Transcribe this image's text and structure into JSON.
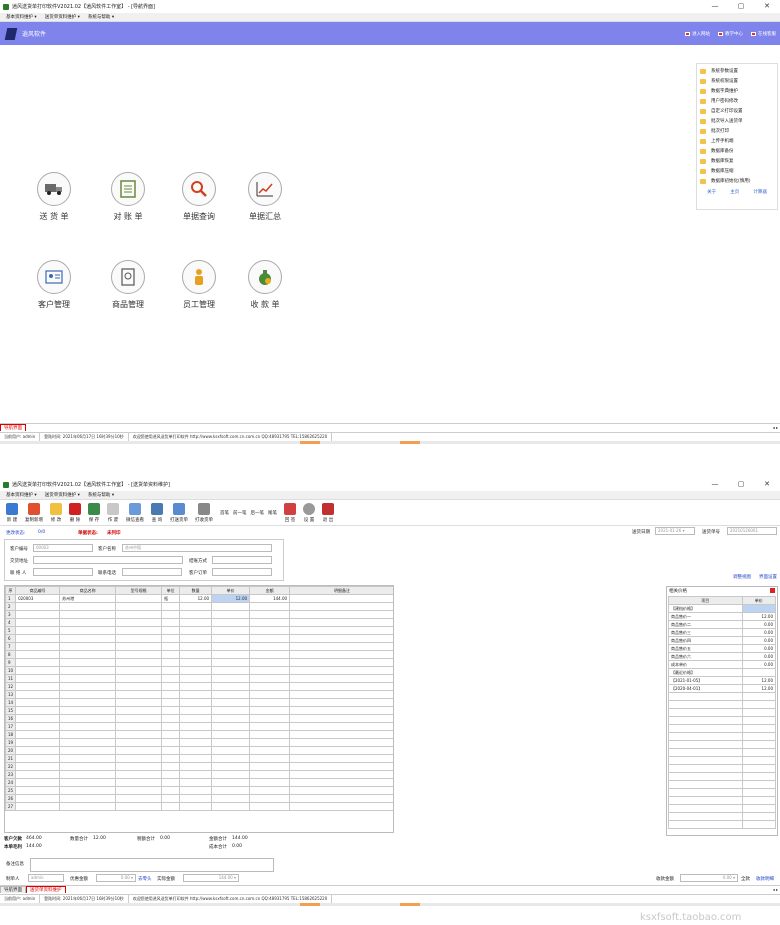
{
  "win1": {
    "title": "逍风送货单打印软件V2021.02【逍风软件工作室】 - [导航界面]",
    "controls": [
      "—",
      "▢",
      "✕"
    ],
    "menu": [
      "基本资料维护 ▾",
      "送货单资料维护 ▾",
      "系统与帮助 ▾"
    ],
    "banner": {
      "name": "逍风软件",
      "links": [
        "进入网站",
        "教学中心",
        "在线客服"
      ]
    },
    "tiles": [
      {
        "label": "送 货 单"
      },
      {
        "label": "对 账 单"
      },
      {
        "label": "单据查询"
      },
      {
        "label": "单据汇总"
      },
      {
        "label": "客户管理"
      },
      {
        "label": "商品管理"
      },
      {
        "label": "员工管理"
      },
      {
        "label": "收 款 单"
      }
    ],
    "sidemenu": [
      "系统参数设置",
      "系统权限设置",
      "数据字典维护",
      "用户密码修改",
      "自定义打印设置",
      "批次导入送货单",
      "批次打印",
      "上传手机端",
      "数据库备份",
      "数据库恢复",
      "数据库压缩",
      "数据库初始化(慎用)"
    ],
    "sidemenu_links": [
      "关于",
      "主页",
      "计算器"
    ],
    "tab": "导航界面",
    "scroll": "◂ ▸",
    "status": [
      "当前用户: admin",
      "登陆时间: 2021年06月17日 16时39分10秒",
      "欢迎您使用逍风送货单打印软件 http://www.ksxfsoft.com.cn.com.cn QQ:48931795 TEL:15862625220"
    ]
  },
  "win2": {
    "title": "逍风送货单打印软件V2021.02【逍风软件工作室】 - [送货单资料维护]",
    "controls": [
      "—",
      "▢",
      "✕"
    ],
    "menu": [
      "基本资料维护 ▾",
      "送货单资料维护 ▾",
      "系统与帮助 ▾"
    ],
    "toolbar": [
      "新 建",
      "复制新增",
      "修 改",
      "删 除",
      "保 存",
      "作 废",
      "微信查看",
      "查 询",
      "打送货单",
      "打收货单",
      "首笔",
      "前一笔",
      "后一笔",
      "尾笔",
      "回 签",
      "设 置",
      "退 出"
    ],
    "status_label": "更改状态: ",
    "status_value": "0/0",
    "doc_label": "单据状态:",
    "doc_value": "未列印",
    "date_label": "送货日期",
    "date_value": "2021-01-26 ▾",
    "no_label": "送货单号",
    "no_value": "20210126001",
    "form": {
      "customer_code_label": "客户编号",
      "customer_code": "00003",
      "customer_name_label": "客户名称",
      "customer_name": "苏州中国",
      "address_label": "交货地址",
      "settle_label": "结账方式",
      "contact_label": "联 络 人",
      "phone_label": "联系电话",
      "order_label": "客户订单"
    },
    "links": [
      "调整视图",
      "界面设置"
    ],
    "grid": {
      "headers": [
        "序",
        "商品编号",
        "商品名称",
        "型号规格",
        "单位",
        "数量",
        "单价",
        "金额",
        "明细备注"
      ],
      "rows": [
        [
          "1",
          "020003",
          "苏州港",
          "",
          "瓶",
          "12.00",
          "12.00",
          "144.00",
          ""
        ]
      ]
    },
    "side_title": "相关价格",
    "side_headers": [
      "项目",
      "单价"
    ],
    "side_rows": [
      [
        "【建档价格】",
        ""
      ],
      [
        "商品售价一",
        "12.00"
      ],
      [
        "商品售价二",
        "0.00"
      ],
      [
        "商品售价三",
        "0.00"
      ],
      [
        "商品售价四",
        "0.00"
      ],
      [
        "商品售价五",
        "0.00"
      ],
      [
        "商品售价六",
        "0.00"
      ],
      [
        "成本单价",
        "0.00"
      ],
      [
        "【最近价格】",
        ""
      ],
      [
        "【2021-01-05】",
        "12.00"
      ],
      [
        "【2020-04-01】",
        "12.00"
      ]
    ],
    "totals": {
      "receivable_label": "客户欠款",
      "receivable": "464.00",
      "qty_label": "数量合计",
      "qty": "12.00",
      "tax_label": "税额合计",
      "tax": "0.00",
      "amount_label": "金额合计",
      "amount": "144.00",
      "profit_label": "本单毛利",
      "profit": "144.00",
      "cost_label": "成本合计",
      "cost": "0.00"
    },
    "remark_label": "备注信息",
    "bottom": {
      "maker_label": "制单人",
      "maker": "admin",
      "discount_label": "优惠金额",
      "discount": "0.00 ▾",
      "pay": "去零头",
      "actual_label": "实际金额",
      "actual": "144.00 ▾",
      "received_label": "收款金额",
      "received": "0.00 ▾",
      "full": "全款",
      "more": "收款明细"
    },
    "tabs": [
      "导航界面",
      "送货单资料维护"
    ],
    "scroll": "◂ ▸",
    "status": [
      "当前用户: admin",
      "登陆时间: 2021年06月17日 16时39分10秒",
      "欢迎您使用逍风送货单打印软件 http://www.ksxfsoft.com.cn.com.cn QQ:48931795 TEL:15862625220"
    ]
  },
  "watermark": "ksxfsoft.taobao.com"
}
